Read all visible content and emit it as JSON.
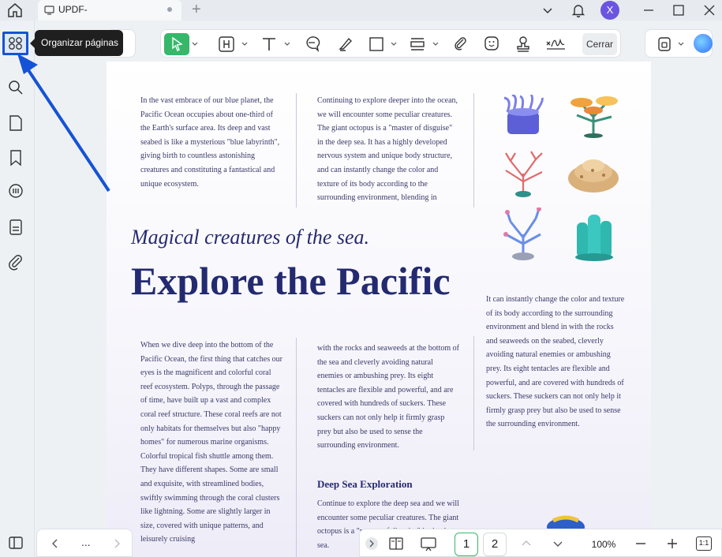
{
  "titlebar": {
    "tab_title": "UPDF-",
    "avatar_letter": "X"
  },
  "sidebar": {
    "tooltip": "Organizar páginas",
    "tool_label_fragment": "as"
  },
  "toolbar": {
    "close_label": "Cerrar"
  },
  "document": {
    "col1_top": "In the vast embrace of our blue planet, the Pacific Ocean occupies about one-third of the Earth's surface area. Its deep and vast seabed is like a mysterious \"blue labyrinth\", giving birth to countless astonishing creatures and constituting a fantastical and unique ecosystem.",
    "col2_top": "Continuing to explore deeper into the ocean, we will encounter some peculiar creatures. The giant octopus is a \"master of disguise\" in the deep sea. It has a highly developed nervous system and unique body structure, and can instantly change the color and texture of its body according to the surrounding environment, blending in",
    "subtitle": "Magical creatures of the sea.",
    "headline": "Explore the Pacific",
    "col3_right": "It can instantly change the color and texture of its body according to the surrounding environment and blend in with the rocks and seaweeds on the seabed, cleverly avoiding natural enemies or ambushing prey. Its eight tentacles are flexible and powerful, and are covered with hundreds of suckers. These suckers can not only help it firmly grasp prey but also be used to sense the surrounding environment.",
    "col1_bottom": "When we dive deep into the bottom of the Pacific Ocean, the first thing that catches our eyes is the magnificent and colorful coral reef ecosystem. Polyps, through the passage of time, have built up a vast and complex coral reef structure. These coral reefs are not only habitats for themselves but also \"happy homes\" for numerous marine organisms. Colorful tropical fish shuttle among them. They have different shapes. Some are small and exquisite, with streamlined bodies, swiftly swimming through the coral clusters like lightning. Some are slightly larger in size, covered with unique patterns, and leisurely cruising",
    "col2_bottom": "with the rocks and seaweeds at the bottom of the sea and cleverly avoiding natural enemies or ambushing prey. Its eight tentacles are flexible and powerful, and are covered with hundreds of suckers. These suckers can not only help it firmly grasp prey but also be used to sense the surrounding environment.",
    "section_heading": "Deep Sea Exploration",
    "section_text": "Continue to explore the deep sea and we will encounter some peculiar creatures. The giant octopus is a \"master of disguise\" in the deep sea."
  },
  "bottombar": {
    "page1": "1",
    "page2": "2",
    "zoom": "100%",
    "fit_label": "1:1",
    "more": "..."
  },
  "colors": {
    "accent_green": "#35b86a",
    "highlight_blue": "#1553d6",
    "heading_navy": "#232a70"
  }
}
